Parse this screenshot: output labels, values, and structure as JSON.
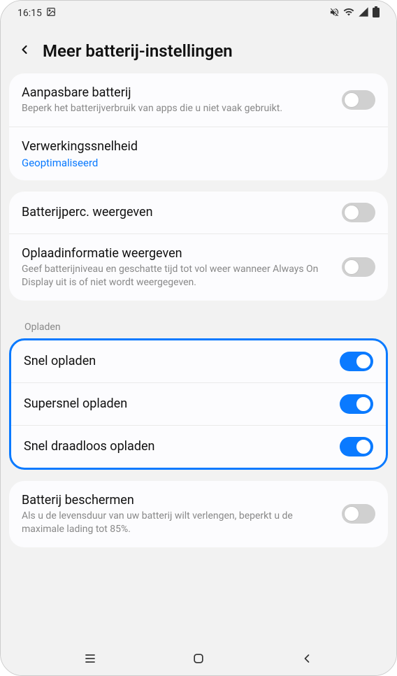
{
  "status_bar": {
    "time": "16:15"
  },
  "header": {
    "title": "Meer batterij-instellingen"
  },
  "sections": {
    "group1": {
      "adaptive": {
        "title": "Aanpasbare batterij",
        "subtitle": "Beperk het batterijverbruik van apps die u niet vaak gebruikt."
      },
      "processing": {
        "title": "Verwerkingssnelheid",
        "value": "Geoptimaliseerd"
      }
    },
    "group2": {
      "percentage": {
        "title": "Batterijperc. weergeven"
      },
      "charge_info": {
        "title": "Oplaadinformatie weergeven",
        "subtitle": "Geef batterijniveau en geschatte tijd tot vol weer wanneer Always On Display uit is of niet wordt weergegeven."
      }
    },
    "charging_label": "Opladen",
    "group3": {
      "fast": {
        "title": "Snel opladen"
      },
      "super_fast": {
        "title": "Supersnel opladen"
      },
      "wireless": {
        "title": "Snel draadloos opladen"
      }
    },
    "group4": {
      "protect": {
        "title": "Batterij beschermen",
        "subtitle": "Als u de levensduur van uw batterij wilt verlengen, beperkt u de maximale lading tot 85%."
      }
    }
  }
}
